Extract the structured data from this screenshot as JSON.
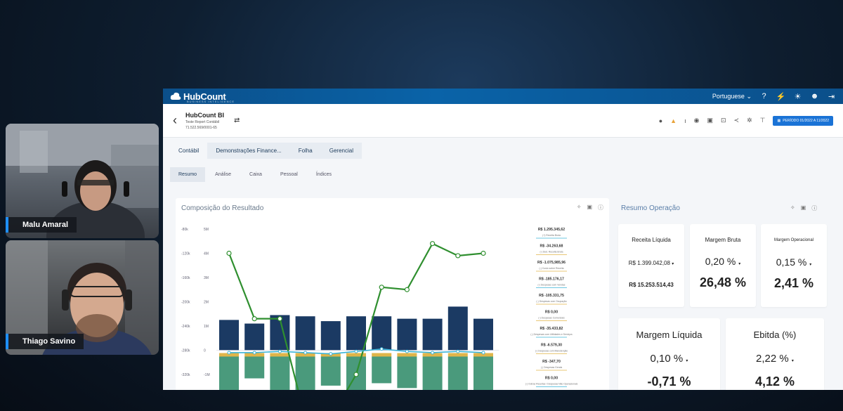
{
  "participants": [
    {
      "name": "Malu Amaral"
    },
    {
      "name": "Thiago Savino"
    }
  ],
  "app": {
    "logo": "HubCount",
    "logo_sub": "BUSINESS INTELIGENCE",
    "language": "Portuguese",
    "header": {
      "title": "HubCount BI",
      "subtitle": "Teste Report Contábil",
      "cnpj": "71.522.569/0001-65",
      "period": "PERÍODO 01/2022 A 11/2022"
    },
    "tabs_primary": [
      "Contábil",
      "Demonstrações Finance...",
      "Folha",
      "Gerencial"
    ],
    "tabs_secondary": [
      "Resumo",
      "Análise",
      "Caixa",
      "Pessoal",
      "Índices"
    ],
    "chart_panel_title": "Composição do Resultado",
    "resumo_title": "Resumo Operação",
    "kpis": {
      "receita_liquida": {
        "label": "Receita Líquida",
        "v1": "R$ 1.399.042,08",
        "v2": "R$ 15.253.514,43"
      },
      "margem_bruta": {
        "label": "Margem Bruta",
        "v1": "0,20 %",
        "v2": "26,48 %"
      },
      "margem_operacional": {
        "label": "Margem Operacional",
        "v1": "0,15 %",
        "v2": "2,41 %"
      },
      "margem_liquida": {
        "label": "Margem Líquida",
        "v1": "0,10 %",
        "v2": "-0,71 %"
      },
      "ebitda": {
        "label": "Ebitda (%)",
        "v1": "2,22 %",
        "v2": "4,12 %"
      }
    },
    "colors": {
      "accent": "#0b5a9c",
      "bar_navy": "#1b3a63",
      "bar_green": "#4a9a7c",
      "line_green": "#2f8f2f",
      "line_cyan": "#3bb4d8"
    }
  },
  "chart_data": {
    "type": "bar",
    "y_left_ticks": [
      "-80k",
      "-120k",
      "-160k",
      "-200k",
      "-240k",
      "-280k",
      "-320k"
    ],
    "y_right_ticks": [
      "5M",
      "4M",
      "3M",
      "2M",
      "1M",
      "0",
      "-1M"
    ],
    "series": [
      {
        "values": [
          1.25,
          1.1,
          1.45,
          1.4,
          1.2,
          1.4,
          1.4,
          1.3,
          1.3,
          1.8,
          1.3
        ]
      },
      {
        "values": [
          -1.5,
          -0.9,
          -1.5,
          -1.5,
          -1.2,
          -1.4,
          -1.1,
          -1.3,
          -1.4,
          -1.6,
          -1.4
        ]
      },
      {
        "values": [
          4.0,
          1.3,
          1.3,
          -2.8,
          -2.8,
          -1.0,
          2.6,
          2.5,
          4.4,
          3.9,
          4.0
        ]
      },
      {
        "values": [
          -0.1,
          -0.1,
          -0.05,
          -0.1,
          -0.15,
          -0.05,
          0.05,
          -0.05,
          -0.1,
          -0.05,
          -0.1
        ]
      }
    ],
    "waterfall_labels": [
      {
        "value": "R$ 1.295.345,62",
        "desc": "(+) Receita Bruta"
      },
      {
        "value": "R$ -34.263,68",
        "desc": "(-) Ded. Receita Bruta"
      },
      {
        "value": "R$ -1.075,985,96",
        "desc": "(-) Custo sobre Receita"
      },
      {
        "value": "R$ -185.176,17",
        "desc": "(-) Despesas com Vendas"
      },
      {
        "value": "R$ -105.331,75",
        "desc": "(-) Despesas com Ocupação"
      },
      {
        "value": "R$ 0,00",
        "desc": "(-) Despesas Comerciais"
      },
      {
        "value": "R$ -35.433,82",
        "desc": "(-) Despesas com Utilidades e Serviços"
      },
      {
        "value": "R$ -6.579,30",
        "desc": "(-) Despesas com Manutenção"
      },
      {
        "value": "R$ -347,70",
        "desc": "(-) Despesas Gerais"
      },
      {
        "value": "R$ 0,00",
        "desc": "(-) Outras Receitas / Despesas Não Operacionais"
      }
    ]
  }
}
